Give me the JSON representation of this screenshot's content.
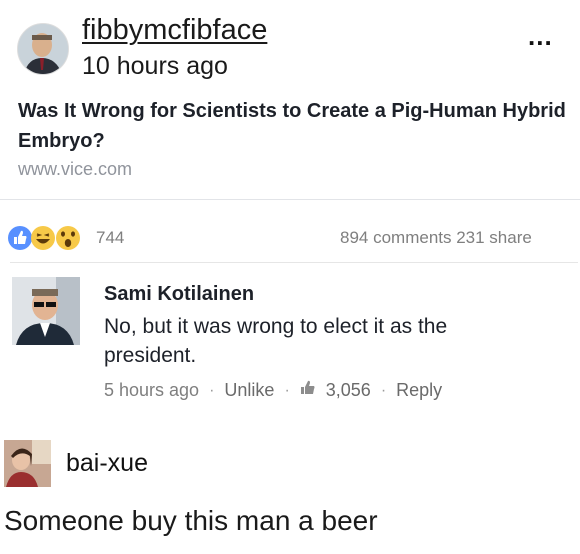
{
  "post": {
    "username": "fibbymcfibface",
    "time": "10 hours ago",
    "more_label": "..."
  },
  "shared_link": {
    "headline": "Was It Wrong for Scientists to Create a Pig-Human Hybrid Embryo?",
    "domain": "www.vice.com"
  },
  "facebook": {
    "reaction_count": "744",
    "comments_shares": "894 comments 231 share",
    "comment": {
      "author": "Sami Kotilainen",
      "text": "No, but it was wrong to elect it as the president.",
      "time": "5 hours ago",
      "unlike": "Unlike",
      "likes": "3,056",
      "reply": "Reply",
      "separator": "·"
    }
  },
  "reply": {
    "username": "bai-xue",
    "text": "Someone buy this man a beer"
  },
  "icons": {
    "like": "thumbs-up-icon",
    "haha": "laughing-face-icon",
    "wow": "surprised-face-icon",
    "likes_small": "thumbs-up-small-icon"
  },
  "colors": {
    "facebook_blue": "#5890ff",
    "emoji_yellow": "#f7c948",
    "meta_gray": "#7f7f7f"
  }
}
